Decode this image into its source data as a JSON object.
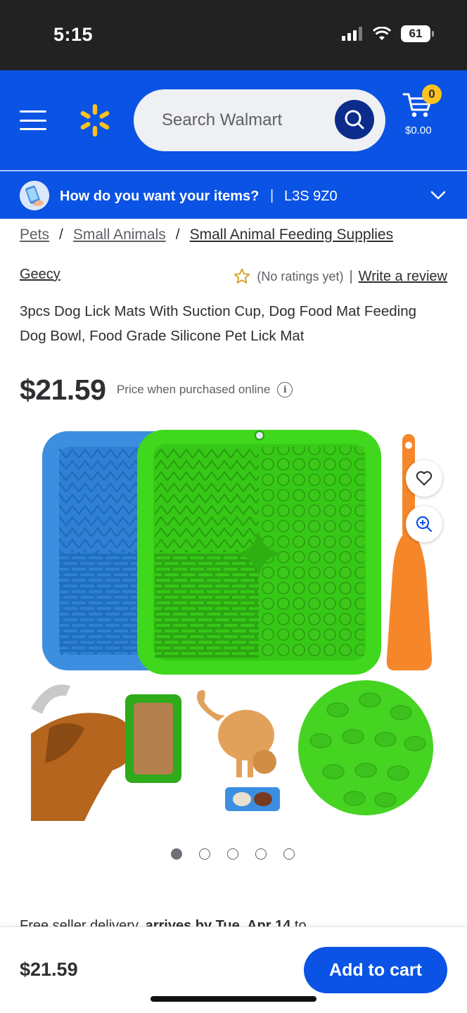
{
  "status_bar": {
    "time": "5:15",
    "battery": "61"
  },
  "header": {
    "search_placeholder": "Search Walmart",
    "cart_count": "0",
    "cart_total": "$0.00",
    "colors": {
      "brand_blue": "#0a53e4",
      "spark_yellow": "#ffc220",
      "search_button": "#0c2c8c"
    }
  },
  "delivery": {
    "question": "How do you want your items?",
    "separator": "|",
    "postal_code": "L3S 9Z0"
  },
  "breadcrumb": {
    "items": [
      "Pets",
      "Small Animals",
      "Small Animal Feeding Supplies"
    ],
    "separator": "/"
  },
  "product": {
    "brand": "Geecy",
    "rating_text": "(No ratings yet)",
    "rating_separator": "|",
    "write_review": "Write a review",
    "title": "3pcs Dog Lick Mats With Suction Cup, Dog Food Mat Feeding Dog Bowl, Food Grade Silicone Pet Lick Mat",
    "price": "$21.59",
    "price_note": "Price when purchased online",
    "info_icon_glyph": "i",
    "image_count": 5,
    "active_image": 1
  },
  "delivery_peek": {
    "text_start": "Free seller delivery, ",
    "text_bold": "arrives by Tue, Apr 14",
    "text_end": " to"
  },
  "bottom_bar": {
    "price": "$21.59",
    "add_to_cart": "Add to cart"
  }
}
